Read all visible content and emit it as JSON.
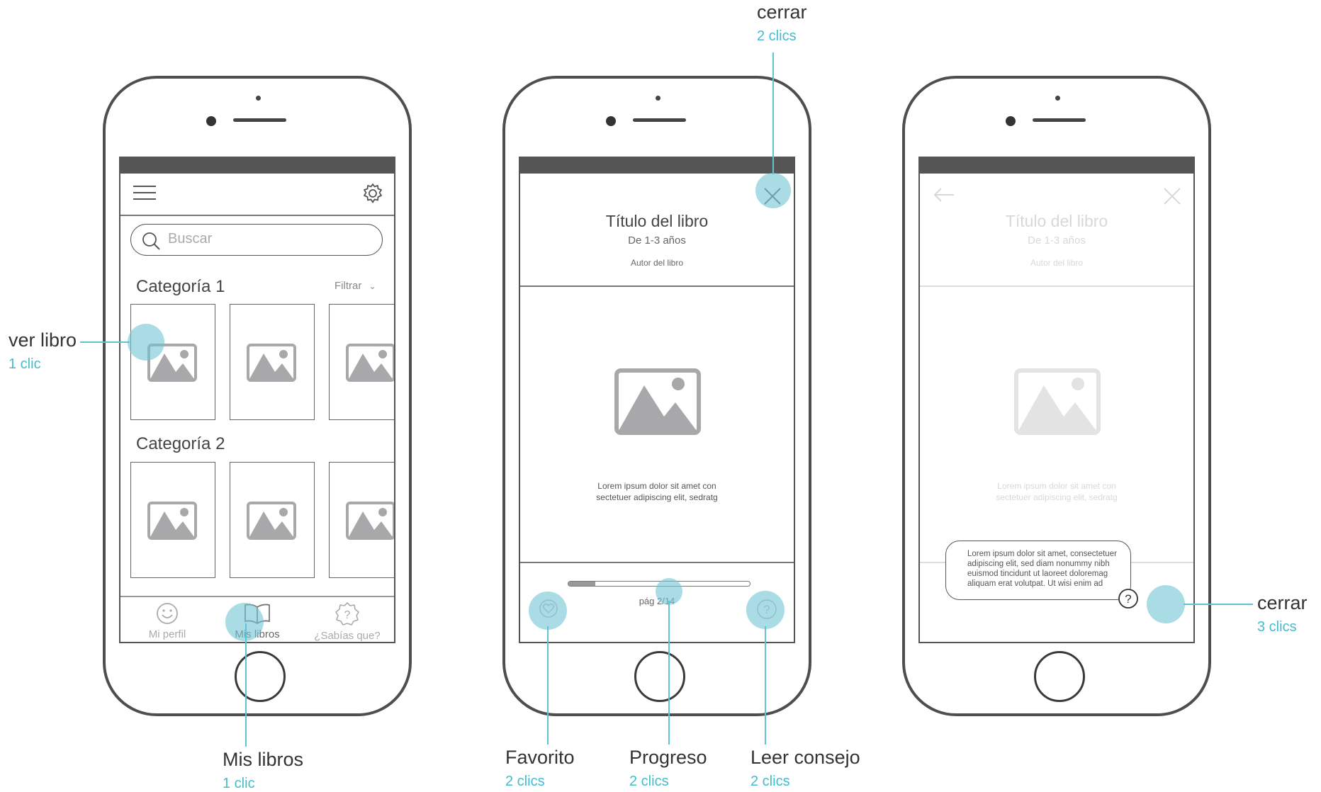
{
  "screens": {
    "home": {
      "search_placeholder": "Buscar",
      "category1_title": "Categoría 1",
      "filter_label": "Filtrar",
      "category2_title": "Categoría 2",
      "nav": [
        {
          "label": "Mi perfil",
          "icon": "smiley-icon"
        },
        {
          "label": "Mis libros",
          "icon": "book-icon"
        },
        {
          "label": "¿Sabías que?",
          "icon": "question-badge-icon"
        }
      ]
    },
    "reader": {
      "book_title": "Título del libro",
      "age_range": "De 1-3 años",
      "author": "Autor del libro",
      "body_text_line1": "Lorem ipsum dolor sit amet con",
      "body_text_line2": "sectetuer adipiscing elit, sedratg",
      "page_indicator": "pág 2/14",
      "progress": 0.15
    },
    "tip": {
      "book_title": "Título del libro",
      "age_range": "De 1-3 años",
      "author": "Autor del libro",
      "body_text_line1": "Lorem ipsum dolor sit amet con",
      "body_text_line2": "sectetuer adipiscing elit, sedratg",
      "tip_line1": "Lorem ipsum dolor sit amet, consectetuer",
      "tip_line2": "adipiscing elit, sed diam nonummy nibh",
      "tip_line3": "euismod tincidunt ut laoreet doloremag",
      "tip_line4": "aliquam erat volutpat. Ut wisi enim ad"
    }
  },
  "annotations": {
    "ver_libro": {
      "label": "ver libro",
      "count": "1 clic"
    },
    "mis_libros": {
      "label": "Mis libros",
      "count": "1 clic"
    },
    "cerrar_top": {
      "label": "cerrar",
      "count": "2 clics"
    },
    "favorito": {
      "label": "Favorito",
      "count": "2 clics"
    },
    "progreso": {
      "label": "Progreso",
      "count": "2 clics"
    },
    "leer_consejo": {
      "label": "Leer consejo",
      "count": "2 clics"
    },
    "cerrar_right": {
      "label": "cerrar",
      "count": "3 clics"
    }
  },
  "colors": {
    "accent": "#44bccd",
    "hotspot": "#71c4d4",
    "wire": "#555555",
    "placeholder": "#a8a8aa"
  }
}
